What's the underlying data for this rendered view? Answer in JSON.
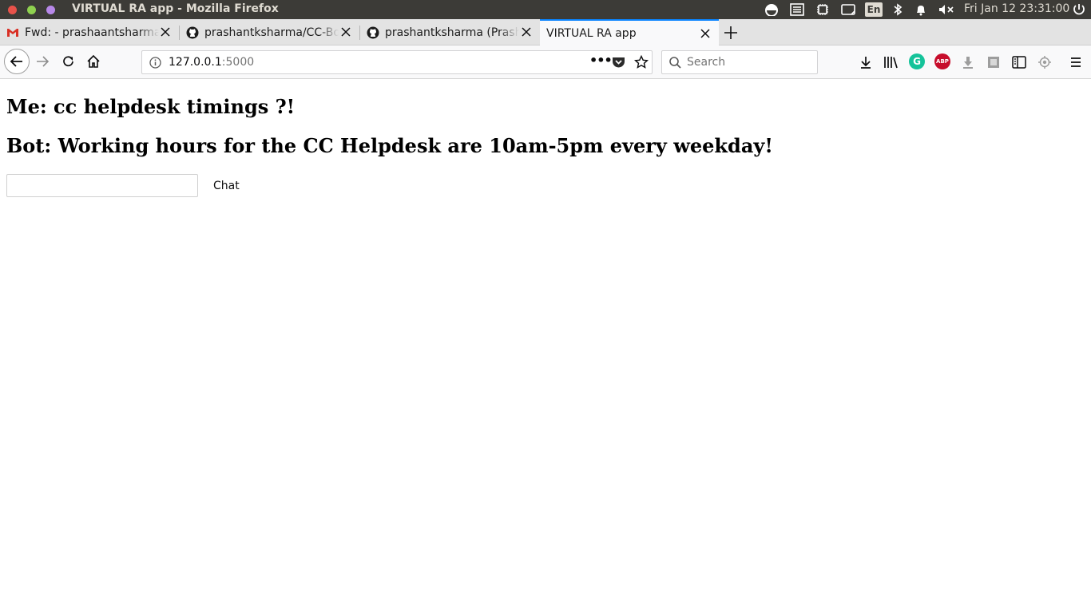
{
  "window": {
    "title": "VIRTUAL RA app - Mozilla Firefox",
    "clock": "Fri Jan 12 23:31:00",
    "keyboard_layout": "En"
  },
  "tabs": [
    {
      "label": "Fwd: - prashaantsharmaa",
      "icon": "gmail-icon"
    },
    {
      "label": "prashantksharma/CC-Bo",
      "icon": "github-icon"
    },
    {
      "label": "prashantksharma (Prash",
      "icon": "github-icon"
    },
    {
      "label": "VIRTUAL RA app",
      "icon": "",
      "active": true
    }
  ],
  "urlbar": {
    "host": "127.0.0.1",
    "port": ":5000",
    "page_actions_label": "•••"
  },
  "searchbar": {
    "placeholder": "Search"
  },
  "extensions": {
    "grammarly": "G",
    "adblock": "ABP"
  },
  "chat": {
    "me_line": "Me: cc helpdesk timings ?!",
    "bot_line": "Bot: Working hours for the CC Helpdesk are 10am-5pm every weekday!",
    "input_value": "",
    "button_label": "Chat"
  },
  "colors": {
    "titlebar_bg": "#3c3b37",
    "active_tab_accent": "#0a84ff",
    "grammarly_green": "#15c39a",
    "abp_red": "#c70d2c"
  }
}
